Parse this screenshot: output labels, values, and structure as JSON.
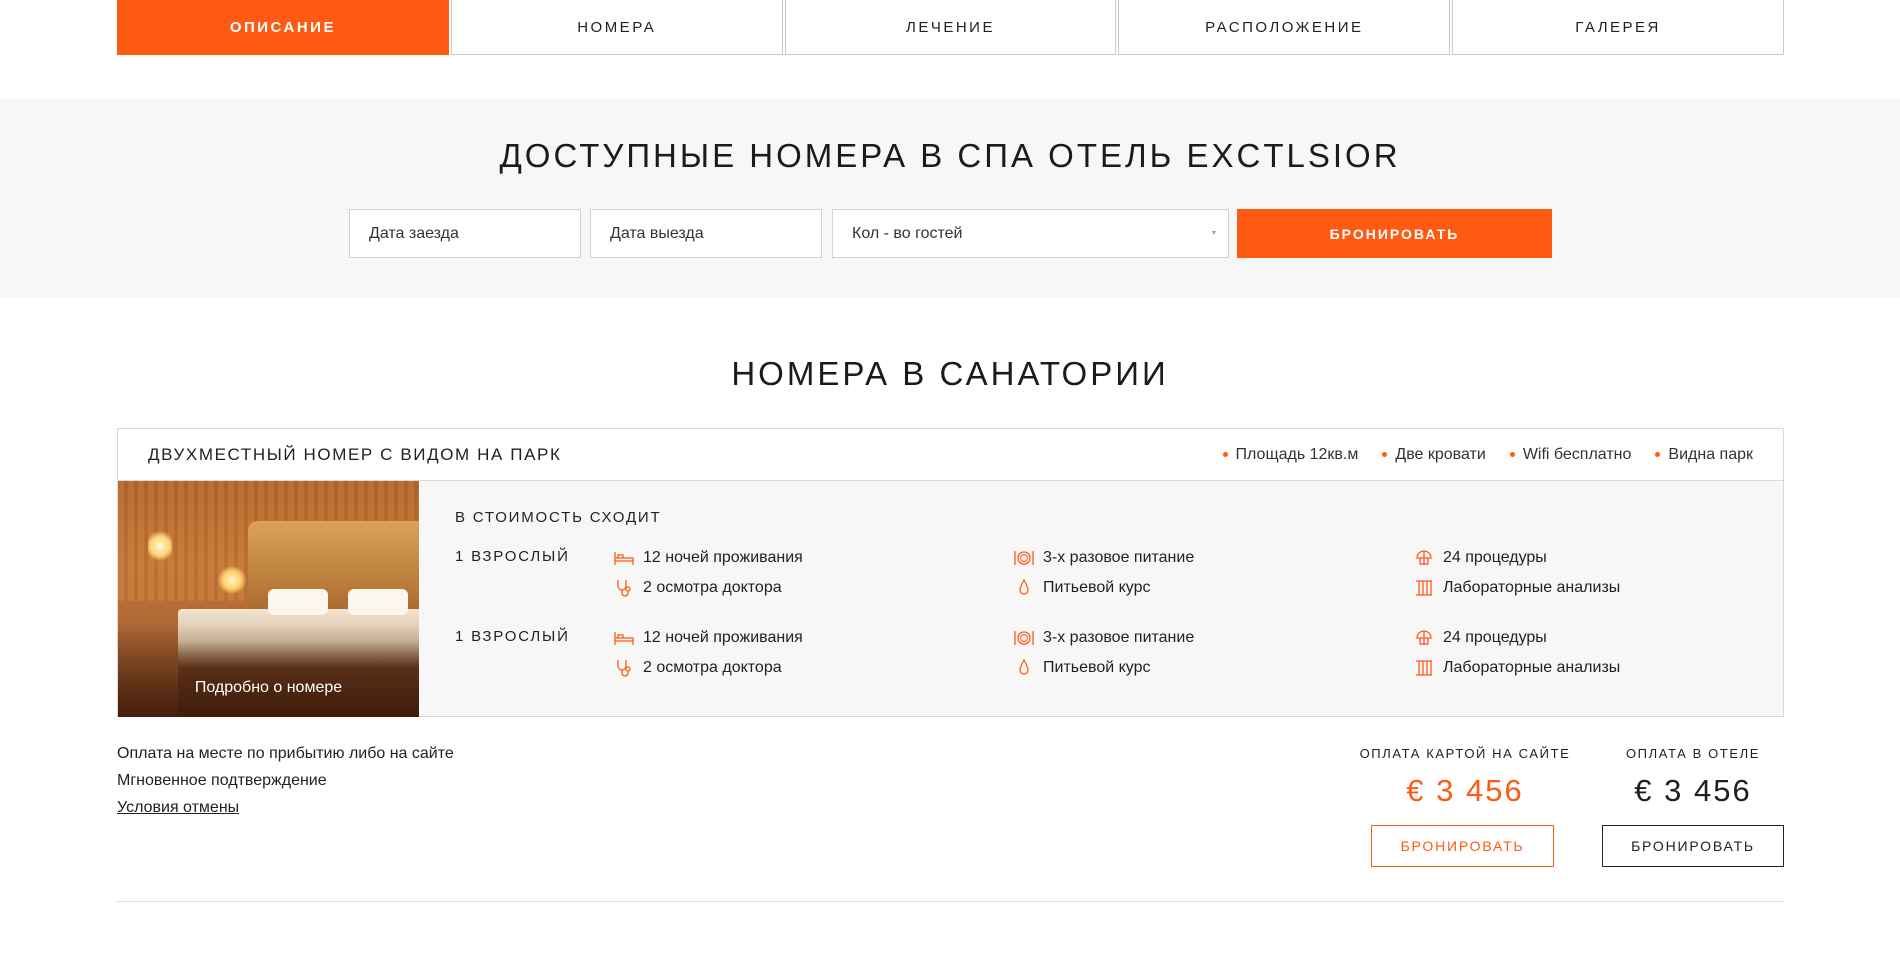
{
  "tabs": [
    {
      "label": "ОПИСАНИЕ",
      "active": true
    },
    {
      "label": "НОМЕРА",
      "active": false
    },
    {
      "label": "ЛЕЧЕНИЕ",
      "active": false
    },
    {
      "label": "РАСПОЛОЖЕНИЕ",
      "active": false
    },
    {
      "label": "ГАЛЕРЕЯ",
      "active": false
    }
  ],
  "availability": {
    "title": "ДОСТУПНЫЕ НОМЕРА В СПА ОТЕЛЬ EXCTLSIOR",
    "checkin_placeholder": "Дата заезда",
    "checkout_placeholder": "Дата выезда",
    "guests_placeholder": "Кол - во гостей",
    "book_label": "БРОНИРОВАТЬ"
  },
  "rooms_title": "НОМЕРА В САНАТОРИИ",
  "room": {
    "name": "ДВУХМЕСТНЫЙ НОМЕР С ВИДОМ НА ПАРК",
    "features": [
      "Площадь 12кв.м",
      "Две кровати",
      "Wifi бесплатно",
      "Видна парк"
    ],
    "photo_link": "Подробно о номере",
    "includes_label": "В СТОИМОСТЬ СХОДИТ",
    "guests": [
      {
        "label": "1 ВЗРОСЛЫЙ",
        "items": {
          "nights": "12 ночей проживания",
          "doctor": "2 осмотра доктора",
          "meals": "3-х разовое питание",
          "drink": "Питьевой курс",
          "procedures": "24 процедуры",
          "lab": "Лабораторные анализы"
        }
      },
      {
        "label": "1 ВЗРОСЛЫЙ",
        "items": {
          "nights": "12 ночей проживания",
          "doctor": "2 осмотра доктора",
          "meals": "3-х разовое питание",
          "drink": "Питьевой курс",
          "procedures": "24 процедуры",
          "lab": "Лабораторные анализы"
        }
      }
    ]
  },
  "payment": {
    "info1": "Оплата на месте по прибытию либо на сайте",
    "info2": "Мгновенное подтверждение",
    "cancel_link": "Условия отмены",
    "card_label": "ОПЛАТА КАРТОЙ НА САЙТЕ",
    "card_price": "€ 3 456",
    "card_button": "БРОНИРОВАТЬ",
    "hotel_label": "ОПЛАТА В ОТЕЛЕ",
    "hotel_price": "€ 3 456",
    "hotel_button": "БРОНИРОВАТЬ"
  },
  "colors": {
    "accent": "#ff5a14",
    "band_bg": "#f7f7f7",
    "text": "#222222"
  }
}
